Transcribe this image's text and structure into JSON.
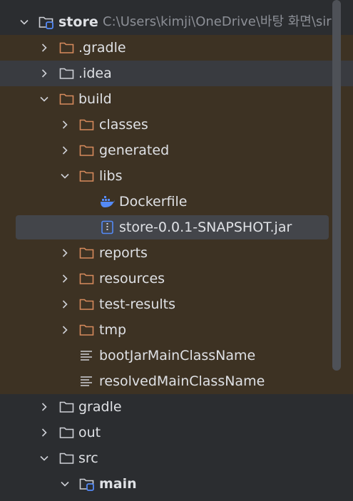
{
  "tree": {
    "root": {
      "name": "store",
      "path": "C:\\Users\\kimji\\OneDrive\\바탕 화면\\sir"
    },
    "nodes": [
      {
        "name": ".gradle",
        "icon": "folder-icon"
      },
      {
        "name": ".idea",
        "icon": "folder-icon"
      },
      {
        "name": "build",
        "icon": "folder-icon",
        "expanded": true
      },
      {
        "name": "classes",
        "icon": "folder-icon"
      },
      {
        "name": "generated",
        "icon": "folder-icon"
      },
      {
        "name": "libs",
        "icon": "folder-icon",
        "expanded": true
      },
      {
        "name": "Dockerfile",
        "icon": "docker-icon"
      },
      {
        "name": "store-0.0.1-SNAPSHOT.jar",
        "icon": "jar-icon",
        "selected": true
      },
      {
        "name": "reports",
        "icon": "folder-icon"
      },
      {
        "name": "resources",
        "icon": "folder-icon"
      },
      {
        "name": "test-results",
        "icon": "folder-icon"
      },
      {
        "name": "tmp",
        "icon": "folder-icon"
      },
      {
        "name": "bootJarMainClassName",
        "icon": "text-file-icon"
      },
      {
        "name": "resolvedMainClassName",
        "icon": "text-file-icon"
      },
      {
        "name": "gradle",
        "icon": "folder-icon"
      },
      {
        "name": "out",
        "icon": "folder-icon"
      },
      {
        "name": "src",
        "icon": "folder-icon",
        "expanded": true
      },
      {
        "name": "main",
        "icon": "module-folder-icon",
        "expanded": true
      }
    ]
  },
  "colors": {
    "background": "#2b2d30",
    "excluded_background": "#3d3223",
    "selection": "#43454a",
    "excluded_folder": "#d68a5c",
    "folder": "#ced0d6",
    "module_badge": "#548af7",
    "docker": "#548af7"
  }
}
